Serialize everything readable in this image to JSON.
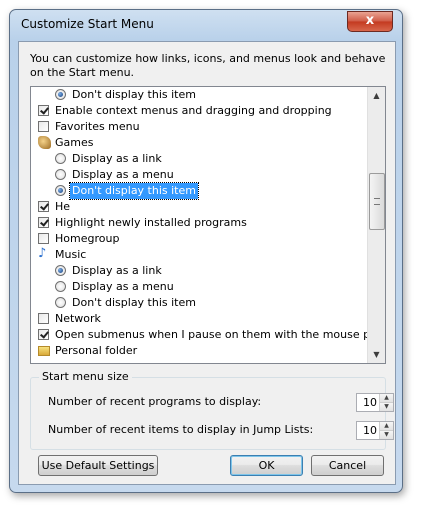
{
  "window": {
    "title": "Customize Start Menu",
    "close_glyph": "x"
  },
  "description": "You can customize how links, icons, and menus look and behave on the Start menu.",
  "list_items": [
    {
      "kind": "radio",
      "indent": 2,
      "checked": true,
      "label": "Don't display this item"
    },
    {
      "kind": "checkbox",
      "indent": 1,
      "checked": true,
      "label": "Enable context menus and dragging and dropping"
    },
    {
      "kind": "checkbox",
      "indent": 1,
      "checked": false,
      "label": "Favorites menu"
    },
    {
      "kind": "icon",
      "icon": "games-icon",
      "indent": 1,
      "label": "Games"
    },
    {
      "kind": "radio",
      "indent": 2,
      "checked": false,
      "label": "Display as a link"
    },
    {
      "kind": "radio",
      "indent": 2,
      "checked": false,
      "label": "Display as a menu"
    },
    {
      "kind": "radio",
      "indent": 2,
      "checked": true,
      "selected": true,
      "label": "Don't display this item"
    },
    {
      "kind": "checkbox",
      "indent": 1,
      "checked": true,
      "label": "He"
    },
    {
      "kind": "checkbox",
      "indent": 1,
      "checked": true,
      "label": "Highlight newly installed programs"
    },
    {
      "kind": "checkbox",
      "indent": 1,
      "checked": false,
      "label": "Homegroup"
    },
    {
      "kind": "icon",
      "icon": "music-icon",
      "indent": 1,
      "label": "Music"
    },
    {
      "kind": "radio",
      "indent": 2,
      "checked": true,
      "label": "Display as a link"
    },
    {
      "kind": "radio",
      "indent": 2,
      "checked": false,
      "label": "Display as a menu"
    },
    {
      "kind": "radio",
      "indent": 2,
      "checked": false,
      "label": "Don't display this item"
    },
    {
      "kind": "checkbox",
      "indent": 1,
      "checked": false,
      "label": "Network"
    },
    {
      "kind": "checkbox",
      "indent": 1,
      "checked": true,
      "label": "Open submenus when I pause on them with the mouse pointer"
    },
    {
      "kind": "icon",
      "icon": "personal-folder-icon",
      "indent": 1,
      "label": "Personal folder"
    }
  ],
  "start_menu_size": {
    "title": "Start menu size",
    "recent_programs_label": "Number of recent programs to display:",
    "recent_programs_value": "10",
    "recent_items_label": "Number of recent items to display in Jump Lists:",
    "recent_items_value": "10"
  },
  "buttons": {
    "defaults": "Use Default Settings",
    "ok": "OK",
    "cancel": "Cancel"
  }
}
